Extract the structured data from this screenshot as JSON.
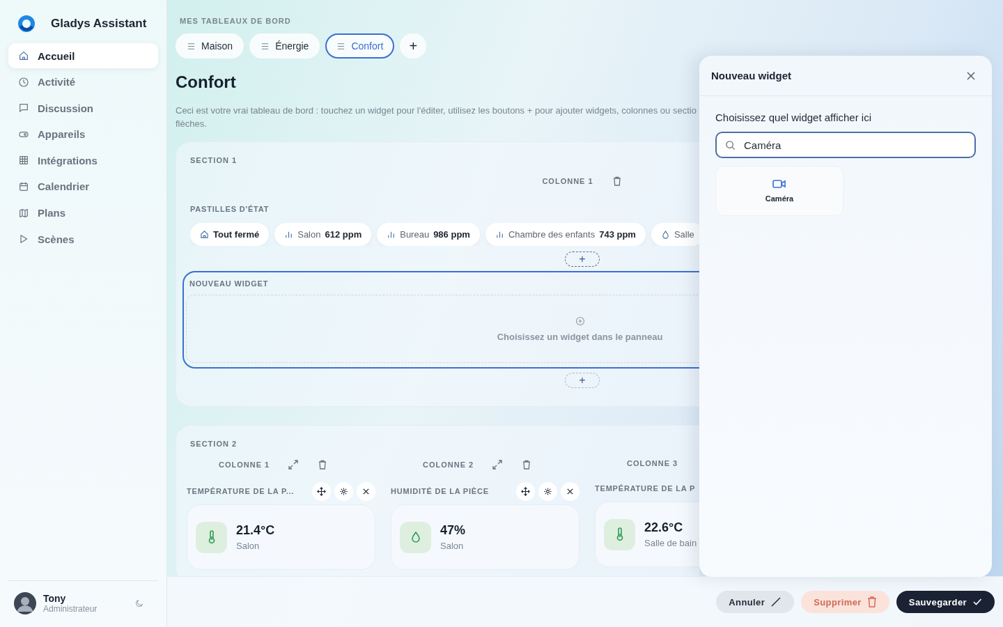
{
  "sidebar": {
    "app_name": "Gladys Assistant",
    "items": [
      {
        "label": "Accueil",
        "selected": true
      },
      {
        "label": "Activité",
        "selected": false
      },
      {
        "label": "Discussion",
        "selected": false
      },
      {
        "label": "Appareils",
        "selected": false
      },
      {
        "label": "Intégrations",
        "selected": false
      },
      {
        "label": "Calendrier",
        "selected": false
      },
      {
        "label": "Plans",
        "selected": false
      },
      {
        "label": "Scènes",
        "selected": false
      }
    ],
    "user": {
      "name": "Tony",
      "role": "Administrateur"
    }
  },
  "dashboards": {
    "label": "MES TABLEAUX DE BORD",
    "tabs": [
      {
        "label": "Maison",
        "selected": false
      },
      {
        "label": "Énergie",
        "selected": false
      },
      {
        "label": "Confort",
        "selected": true
      }
    ],
    "add": "+"
  },
  "title": "Confort",
  "description": "Ceci est votre vrai tableau de bord : touchez un widget pour l'éditer, utilisez les boutons + pour ajouter widgets, colonnes ou sectio flèches.",
  "sections": [
    {
      "title": "SECTION 1",
      "columns": [
        {
          "title": "COLONNE 1",
          "expand": false,
          "widgets": [
            {
              "kind": "chips",
              "title": "PASTILLES D'ÉTAT",
              "selected": false,
              "chips": [
                {
                  "kind": "home",
                  "label": "Tout fermé",
                  "emphasis": true
                },
                {
                  "kind": "chart",
                  "label": "Salon",
                  "value": "612 ppm",
                  "emphasis": false
                },
                {
                  "kind": "chart",
                  "label": "Bureau",
                  "value": "986 ppm",
                  "emphasis": false
                },
                {
                  "kind": "chart",
                  "label": "Chambre des enfants",
                  "value": "743 ppm",
                  "emphasis": false
                },
                {
                  "kind": "drop",
                  "label": "Salle",
                  "emphasis": false
                }
              ]
            },
            {
              "kind": "empty",
              "title": "NOUVEAU WIDGET",
              "selected": true,
              "hint": "Choisissez un widget dans le panneau"
            }
          ],
          "add": "+",
          "add_after": "+"
        }
      ]
    },
    {
      "title": "SECTION 2",
      "columns": [
        {
          "title": "COLONNE 1",
          "expand": true,
          "widgets": [
            {
              "kind": "temperature",
              "title": "TEMPÉRATURE DE LA P...",
              "actions": true,
              "value": "21.4°C",
              "room": "Salon"
            }
          ]
        },
        {
          "title": "COLONNE 2",
          "expand": true,
          "widgets": [
            {
              "kind": "humidity",
              "title": "HUMIDITÉ DE LA PIÈCE",
              "actions": true,
              "value": "47%",
              "room": "Salon"
            }
          ]
        },
        {
          "title": "COLONNE 3",
          "expand": false,
          "widgets": [
            {
              "kind": "temperature",
              "title": "TEMPÉRATURE DE LA P",
              "value": "22.6°C",
              "room": "Salle de bain"
            }
          ]
        }
      ]
    }
  ],
  "panel": {
    "title": "Nouveau widget",
    "prompt": "Choisissez quel widget afficher ici",
    "search": {
      "value": "Caméra"
    },
    "results": [
      {
        "label": "Caméra"
      }
    ]
  },
  "footer": {
    "buttons": [
      {
        "kind": "cancel",
        "label": "Annuler"
      },
      {
        "kind": "delete",
        "label": "Supprimer"
      },
      {
        "kind": "save",
        "label": "Sauvegarder"
      }
    ]
  }
}
